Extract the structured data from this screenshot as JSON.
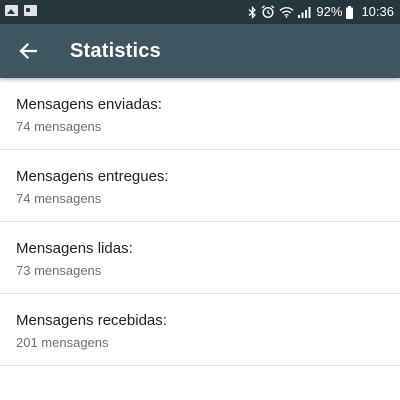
{
  "status_bar": {
    "left_icons": [
      "image-notification-icon",
      "card-notification-icon"
    ],
    "right_icons": [
      "bluetooth-icon",
      "alarm-icon",
      "wifi-icon",
      "signal-icon",
      "battery-icon"
    ],
    "battery": "92%",
    "time": "10:36"
  },
  "app_bar": {
    "title": "Statistics",
    "back_icon": "arrow-left-icon",
    "background": "#3f5660",
    "status_bar_background": "#27363c"
  },
  "stats": [
    {
      "label": "Mensagens enviadas:",
      "value": "74 mensagens"
    },
    {
      "label": "Mensagens entregues:",
      "value": "74 mensagens"
    },
    {
      "label": "Mensagens lidas:",
      "value": "73 mensagens"
    },
    {
      "label": "Mensagens recebidas:",
      "value": "201 mensagens"
    }
  ]
}
